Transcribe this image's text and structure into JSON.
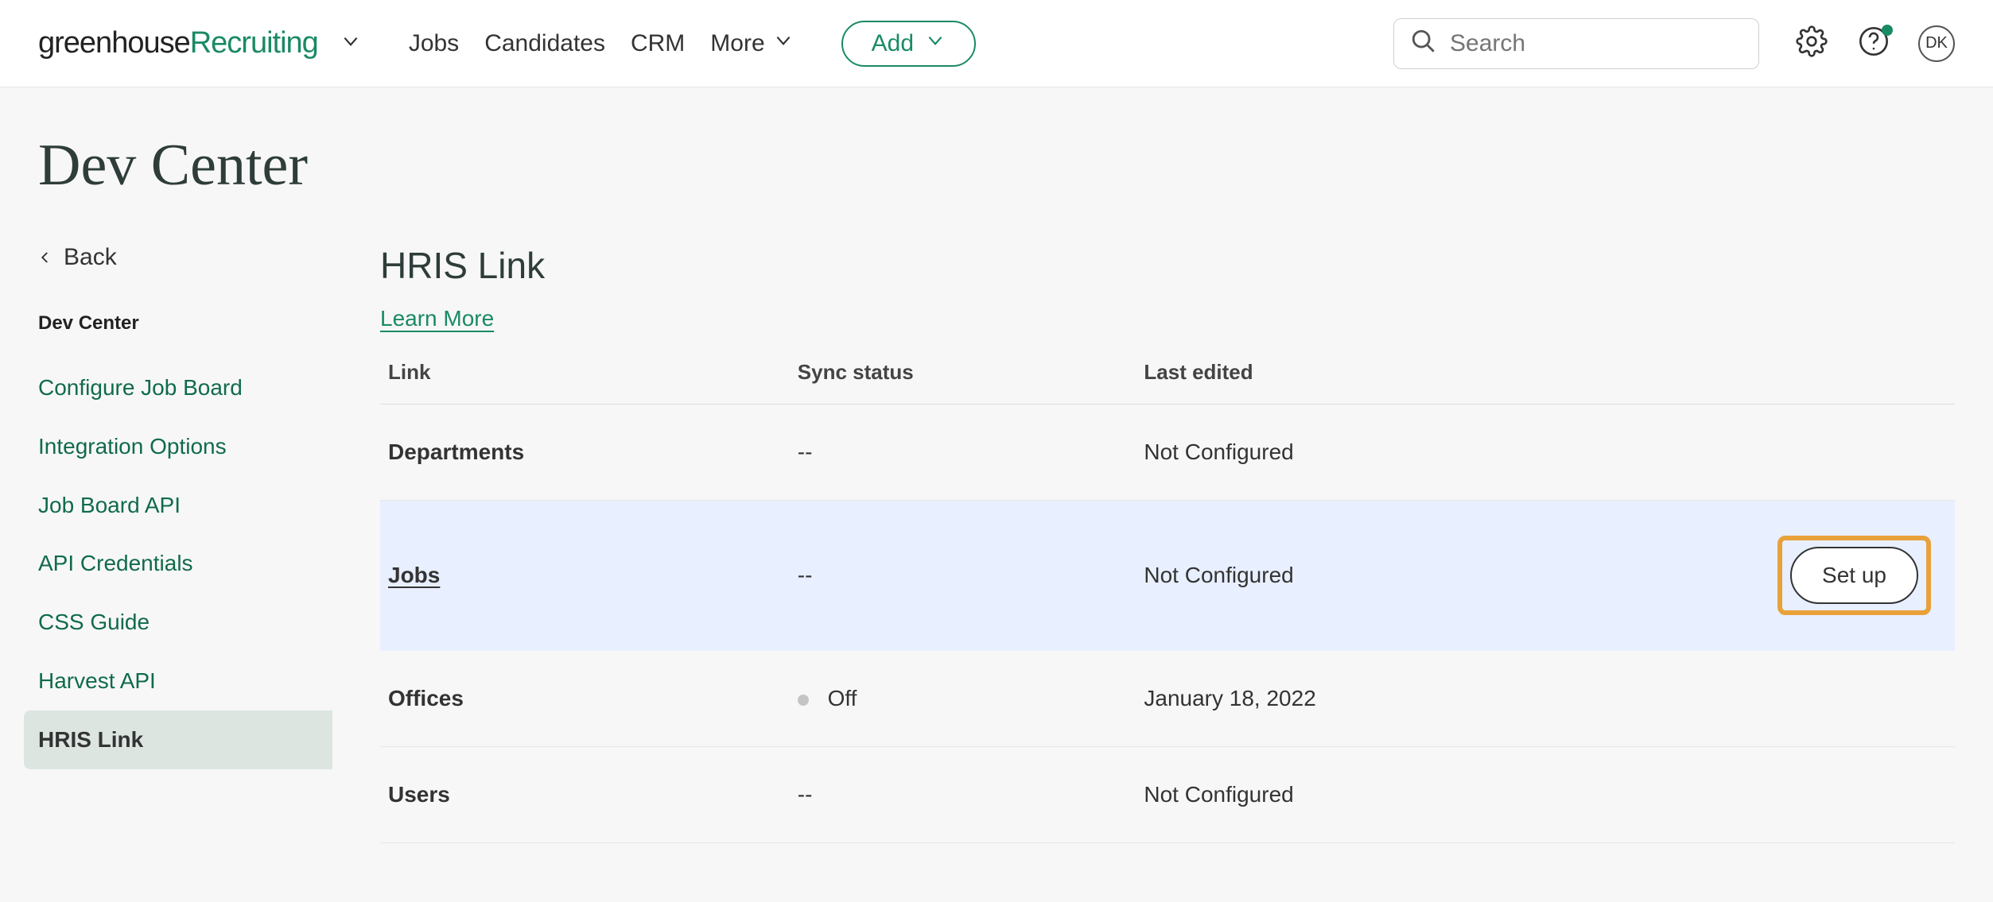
{
  "brand": {
    "part1": "greenhouse ",
    "part2": "Recruiting"
  },
  "nav": {
    "items": [
      {
        "label": "Jobs"
      },
      {
        "label": "Candidates"
      },
      {
        "label": "CRM"
      },
      {
        "label": "More"
      }
    ],
    "add_label": "Add",
    "search_placeholder": "Search",
    "avatar_initials": "DK"
  },
  "page_title": "Dev Center",
  "sidebar": {
    "back_label": "Back",
    "section_label": "Dev Center",
    "items": [
      {
        "label": "Configure Job Board",
        "active": false
      },
      {
        "label": "Integration Options",
        "active": false
      },
      {
        "label": "Job Board API",
        "active": false
      },
      {
        "label": "API Credentials",
        "active": false
      },
      {
        "label": "CSS Guide",
        "active": false
      },
      {
        "label": "Harvest API",
        "active": false
      },
      {
        "label": "HRIS Link",
        "active": true
      }
    ]
  },
  "content": {
    "section_title": "HRIS Link",
    "learn_more_label": "Learn More",
    "columns": {
      "link": "Link",
      "sync": "Sync status",
      "edited": "Last edited"
    },
    "rows": [
      {
        "name": "Departments",
        "sync": "--",
        "edited": "Not Configured",
        "highlighted": false,
        "underline": false,
        "has_dot": false,
        "setup": false
      },
      {
        "name": "Jobs",
        "sync": "--",
        "edited": "Not Configured",
        "highlighted": true,
        "underline": true,
        "has_dot": false,
        "setup": true
      },
      {
        "name": "Offices",
        "sync": "Off",
        "edited": "January 18, 2022",
        "highlighted": false,
        "underline": false,
        "has_dot": true,
        "setup": false
      },
      {
        "name": "Users",
        "sync": "--",
        "edited": "Not Configured",
        "highlighted": false,
        "underline": false,
        "has_dot": false,
        "setup": false
      }
    ],
    "setup_label": "Set up"
  }
}
